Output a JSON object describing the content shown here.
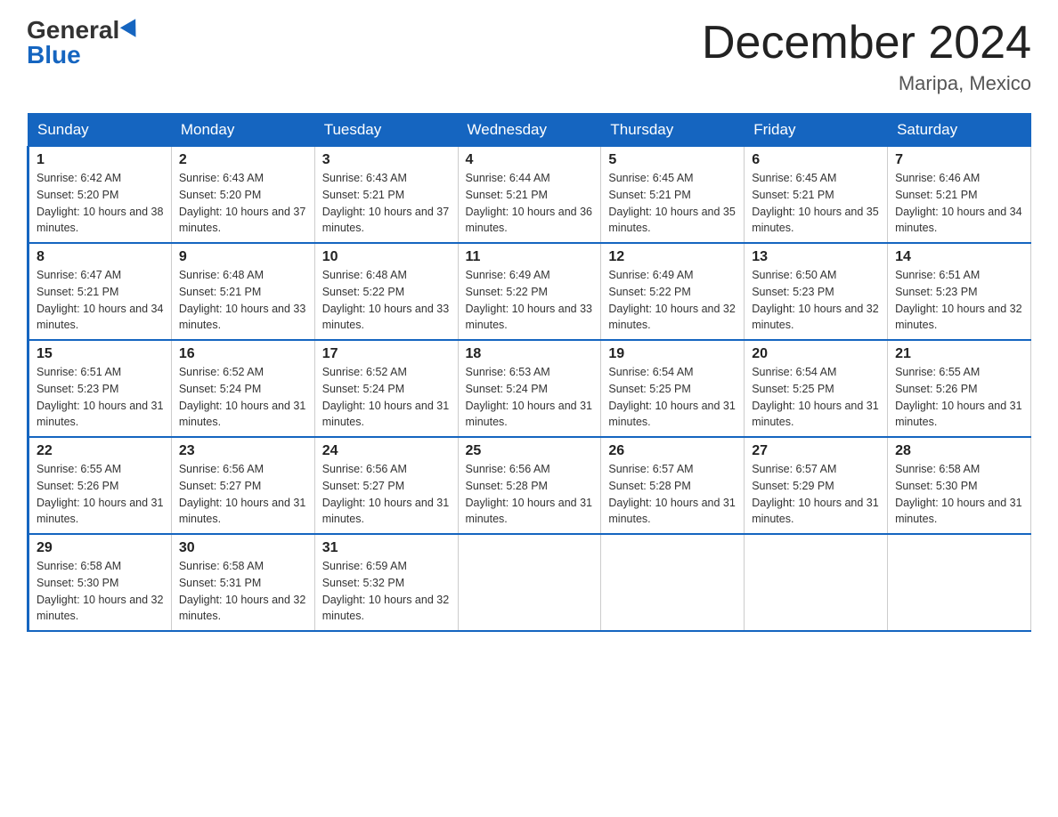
{
  "logo": {
    "general": "General",
    "blue": "Blue"
  },
  "title": {
    "month_year": "December 2024",
    "location": "Maripa, Mexico"
  },
  "days_of_week": [
    "Sunday",
    "Monday",
    "Tuesday",
    "Wednesday",
    "Thursday",
    "Friday",
    "Saturday"
  ],
  "weeks": [
    [
      {
        "date": "1",
        "sunrise": "6:42 AM",
        "sunset": "5:20 PM",
        "daylight": "10 hours and 38 minutes."
      },
      {
        "date": "2",
        "sunrise": "6:43 AM",
        "sunset": "5:20 PM",
        "daylight": "10 hours and 37 minutes."
      },
      {
        "date": "3",
        "sunrise": "6:43 AM",
        "sunset": "5:21 PM",
        "daylight": "10 hours and 37 minutes."
      },
      {
        "date": "4",
        "sunrise": "6:44 AM",
        "sunset": "5:21 PM",
        "daylight": "10 hours and 36 minutes."
      },
      {
        "date": "5",
        "sunrise": "6:45 AM",
        "sunset": "5:21 PM",
        "daylight": "10 hours and 35 minutes."
      },
      {
        "date": "6",
        "sunrise": "6:45 AM",
        "sunset": "5:21 PM",
        "daylight": "10 hours and 35 minutes."
      },
      {
        "date": "7",
        "sunrise": "6:46 AM",
        "sunset": "5:21 PM",
        "daylight": "10 hours and 34 minutes."
      }
    ],
    [
      {
        "date": "8",
        "sunrise": "6:47 AM",
        "sunset": "5:21 PM",
        "daylight": "10 hours and 34 minutes."
      },
      {
        "date": "9",
        "sunrise": "6:48 AM",
        "sunset": "5:21 PM",
        "daylight": "10 hours and 33 minutes."
      },
      {
        "date": "10",
        "sunrise": "6:48 AM",
        "sunset": "5:22 PM",
        "daylight": "10 hours and 33 minutes."
      },
      {
        "date": "11",
        "sunrise": "6:49 AM",
        "sunset": "5:22 PM",
        "daylight": "10 hours and 33 minutes."
      },
      {
        "date": "12",
        "sunrise": "6:49 AM",
        "sunset": "5:22 PM",
        "daylight": "10 hours and 32 minutes."
      },
      {
        "date": "13",
        "sunrise": "6:50 AM",
        "sunset": "5:23 PM",
        "daylight": "10 hours and 32 minutes."
      },
      {
        "date": "14",
        "sunrise": "6:51 AM",
        "sunset": "5:23 PM",
        "daylight": "10 hours and 32 minutes."
      }
    ],
    [
      {
        "date": "15",
        "sunrise": "6:51 AM",
        "sunset": "5:23 PM",
        "daylight": "10 hours and 31 minutes."
      },
      {
        "date": "16",
        "sunrise": "6:52 AM",
        "sunset": "5:24 PM",
        "daylight": "10 hours and 31 minutes."
      },
      {
        "date": "17",
        "sunrise": "6:52 AM",
        "sunset": "5:24 PM",
        "daylight": "10 hours and 31 minutes."
      },
      {
        "date": "18",
        "sunrise": "6:53 AM",
        "sunset": "5:24 PM",
        "daylight": "10 hours and 31 minutes."
      },
      {
        "date": "19",
        "sunrise": "6:54 AM",
        "sunset": "5:25 PM",
        "daylight": "10 hours and 31 minutes."
      },
      {
        "date": "20",
        "sunrise": "6:54 AM",
        "sunset": "5:25 PM",
        "daylight": "10 hours and 31 minutes."
      },
      {
        "date": "21",
        "sunrise": "6:55 AM",
        "sunset": "5:26 PM",
        "daylight": "10 hours and 31 minutes."
      }
    ],
    [
      {
        "date": "22",
        "sunrise": "6:55 AM",
        "sunset": "5:26 PM",
        "daylight": "10 hours and 31 minutes."
      },
      {
        "date": "23",
        "sunrise": "6:56 AM",
        "sunset": "5:27 PM",
        "daylight": "10 hours and 31 minutes."
      },
      {
        "date": "24",
        "sunrise": "6:56 AM",
        "sunset": "5:27 PM",
        "daylight": "10 hours and 31 minutes."
      },
      {
        "date": "25",
        "sunrise": "6:56 AM",
        "sunset": "5:28 PM",
        "daylight": "10 hours and 31 minutes."
      },
      {
        "date": "26",
        "sunrise": "6:57 AM",
        "sunset": "5:28 PM",
        "daylight": "10 hours and 31 minutes."
      },
      {
        "date": "27",
        "sunrise": "6:57 AM",
        "sunset": "5:29 PM",
        "daylight": "10 hours and 31 minutes."
      },
      {
        "date": "28",
        "sunrise": "6:58 AM",
        "sunset": "5:30 PM",
        "daylight": "10 hours and 31 minutes."
      }
    ],
    [
      {
        "date": "29",
        "sunrise": "6:58 AM",
        "sunset": "5:30 PM",
        "daylight": "10 hours and 32 minutes."
      },
      {
        "date": "30",
        "sunrise": "6:58 AM",
        "sunset": "5:31 PM",
        "daylight": "10 hours and 32 minutes."
      },
      {
        "date": "31",
        "sunrise": "6:59 AM",
        "sunset": "5:32 PM",
        "daylight": "10 hours and 32 minutes."
      },
      null,
      null,
      null,
      null
    ]
  ]
}
